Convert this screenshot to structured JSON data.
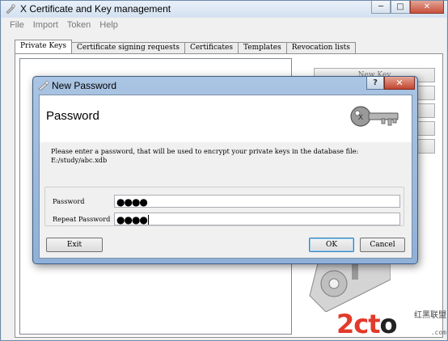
{
  "window": {
    "title": "X Certificate and Key management",
    "buttons": {
      "minimize": "─",
      "maximize": "□",
      "close": "✕"
    }
  },
  "menu": [
    "File",
    "Import",
    "Token",
    "Help"
  ],
  "tabs": [
    {
      "label": "Private Keys",
      "active": true
    },
    {
      "label": "Certificate signing requests",
      "active": false
    },
    {
      "label": "Certificates",
      "active": false
    },
    {
      "label": "Templates",
      "active": false
    },
    {
      "label": "Revocation lists",
      "active": false
    }
  ],
  "side_buttons": {
    "new_key": "New Key"
  },
  "dialog": {
    "title": "New Password",
    "help_label": "?",
    "close_label": "✕",
    "heading": "Password",
    "description_line1": "Please enter a password, that will be used to encrypt your private keys in the database file:",
    "description_line2": "E:/study/abc.xdb",
    "password_label": "Password",
    "password_value": "●●●●",
    "repeat_label": "Repeat Password",
    "repeat_value": "●●●●",
    "exit_label": "Exit",
    "ok_label": "OK",
    "cancel_label": "Cancel"
  },
  "watermark": {
    "logo_left": "2ct",
    "logo_dot": "o",
    "logo_right": ".com",
    "cn_text": "红黑联盟",
    "url": ".com"
  },
  "colors": {
    "titlebar": "#d3e1f0",
    "dialog_frame": "#8fb0d8",
    "close_button": "#c24530",
    "default_button_border": "#3c7fb1",
    "watermark_red": "#e23a2b"
  },
  "icons": [
    "app-certificate-icon",
    "key-icon",
    "help-icon",
    "close-icon"
  ]
}
